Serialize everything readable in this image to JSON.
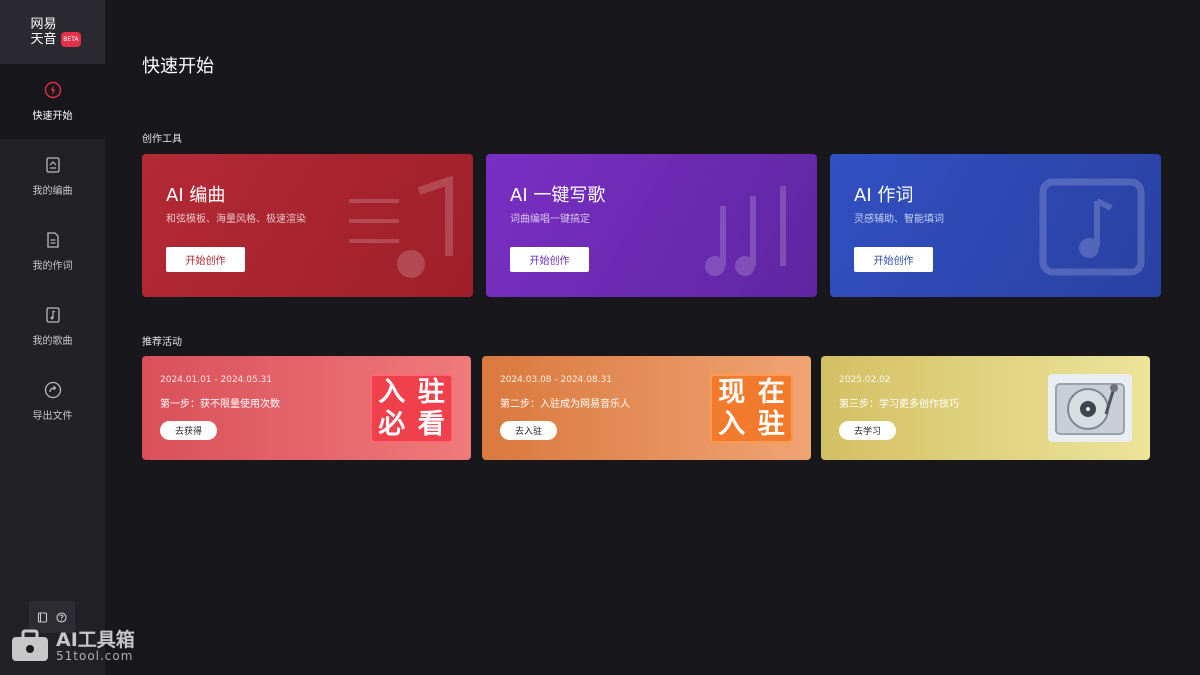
{
  "logo": {
    "line1": "网易",
    "line2": "天音",
    "beta": "BETA"
  },
  "sidebar": {
    "items": [
      {
        "label": "快速开始",
        "icon": "lightning-icon"
      },
      {
        "label": "我的编曲",
        "icon": "score-icon"
      },
      {
        "label": "我的作词",
        "icon": "document-icon"
      },
      {
        "label": "我的歌曲",
        "icon": "song-file-icon"
      },
      {
        "label": "导出文件",
        "icon": "export-icon"
      }
    ]
  },
  "page": {
    "title": "快速开始"
  },
  "sections": {
    "tools": "创作工具",
    "activities": "推荐活动"
  },
  "tools": [
    {
      "title": "AI 编曲",
      "subtitle": "和弦模板、海量风格、极速渲染",
      "button": "开始创作",
      "color": "#a9232f"
    },
    {
      "title": "AI 一键写歌",
      "subtitle": "词曲编唱一键搞定",
      "button": "开始创作",
      "color": "#6a2bb2"
    },
    {
      "title": "AI 作词",
      "subtitle": "灵感辅助、智能填词",
      "button": "开始创作",
      "color": "#2c49b0"
    }
  ],
  "activities": [
    {
      "date": "2024.01.01 - 2024.05.31",
      "step": "第一步：获不限量使用次数",
      "button": "去获得",
      "badge": [
        "入",
        "驻",
        "必",
        "看"
      ]
    },
    {
      "date": "2024.03.08 - 2024.08.31",
      "step": "第二步：入驻成为网易音乐人",
      "button": "去入驻",
      "badge": [
        "现",
        "在",
        "入",
        "驻"
      ]
    },
    {
      "date": "2025.02.02",
      "step": "第三步：学习更多创作技巧",
      "button": "去学习"
    }
  ],
  "watermark": {
    "title": "AI工具箱",
    "url": "51tool.com"
  }
}
